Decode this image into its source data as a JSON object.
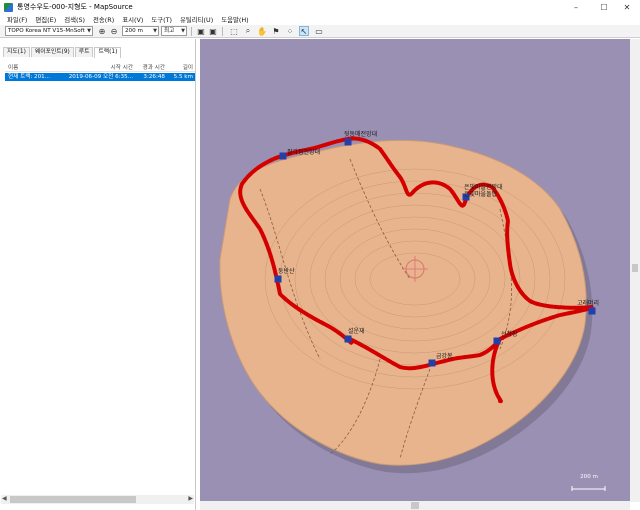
{
  "window": {
    "title": "통영수우도-000-지형도 - MapSource",
    "minimize": "–",
    "maximize": "☐",
    "close": "✕"
  },
  "menu": [
    "파일(F)",
    "편집(E)",
    "검색(S)",
    "전송(R)",
    "표시(V)",
    "도구(T)",
    "유틸리티(U)",
    "도움말(H)"
  ],
  "toolbar": {
    "map_product": "TOPO Korea NT V15-MnSoft",
    "scale": "200 m",
    "detail": "최고"
  },
  "sidebar": {
    "tabs": [
      "지도(1)",
      "웨이포인트(9)",
      "루트",
      "트랙(1)"
    ],
    "active_tab": 3,
    "columns": {
      "name": "이름",
      "start": "시작 시간",
      "elapsed": "경과 시간",
      "length": "길이"
    },
    "rows": [
      {
        "name": "현재 트랙: 201...",
        "start": "2019-06-09 오전 6:35...",
        "elapsed": "3:26:48",
        "length": "5.5 km"
      }
    ]
  },
  "map": {
    "waypoints": [
      "팔각정전망대",
      "뒷동매전망대",
      "은빛마을전망대",
      "은빛마을돌탑",
      "둥반산",
      "고래머리",
      "설운재",
      "금강봉",
      "선착장"
    ],
    "scale_label": "200 m",
    "colors": {
      "sea": "#9a90b3",
      "land": "#e7b48d",
      "track": "#d40000"
    }
  }
}
